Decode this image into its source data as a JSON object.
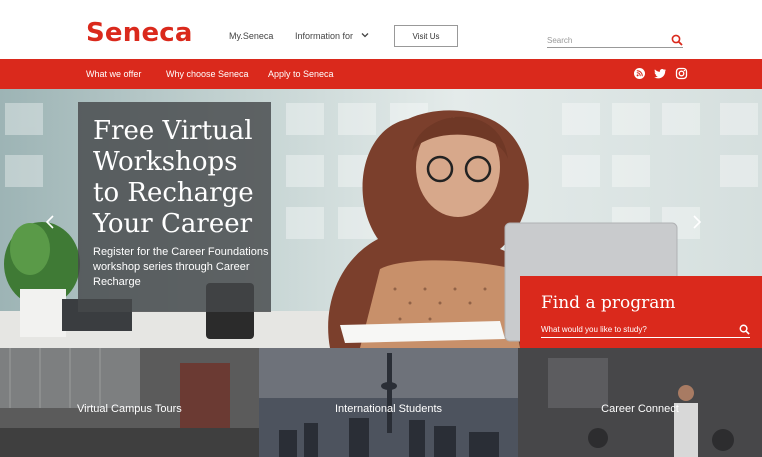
{
  "header": {
    "logo": "Seneca",
    "links": [
      "My.Seneca",
      "Information for"
    ],
    "visit_button": "Visit Us",
    "search_placeholder": "Search"
  },
  "nav": {
    "items": [
      "What we offer",
      "Why choose Seneca",
      "Apply to Seneca"
    ],
    "social_icons": [
      "rss-icon",
      "twitter-icon",
      "instagram-icon"
    ]
  },
  "hero": {
    "title": "Free Virtual Workshops to Recharge Your Career",
    "subtitle": "Register for the Career Foundations workshop series through Career Recharge"
  },
  "find_program": {
    "title": "Find a program",
    "placeholder": "What would you like to study?"
  },
  "tiles": [
    "Virtual Campus Tours",
    "International Students",
    "Career Connect"
  ],
  "colors": {
    "brand_red": "#da291c",
    "hero_panel": "#46484a"
  }
}
